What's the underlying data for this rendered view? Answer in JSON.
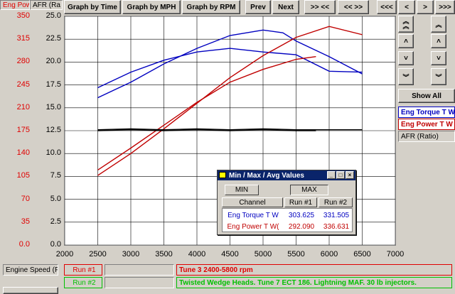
{
  "toolbar": {
    "eng_pow_label": "Eng Pow",
    "afr_label": "AFR (Ra",
    "graph_by_time": "Graph by Time",
    "graph_by_mph": "Graph by MPH",
    "graph_by_rpm": "Graph by RPM",
    "prev": "Prev",
    "next": "Next",
    "zoom_in": ">> <<",
    "zoom_out": "<< >>",
    "scroll_far_left": "<<<",
    "scroll_left": "<",
    "scroll_right": ">",
    "scroll_far_right": ">>>"
  },
  "left_axis": {
    "ticks": [
      "350",
      "315",
      "280",
      "245",
      "210",
      "175",
      "140",
      "105",
      "70",
      "35",
      "0.0"
    ],
    "color": "#e00000"
  },
  "right_panel": {
    "show_all": "Show All",
    "legend": [
      {
        "label": "Eng Torque T W",
        "color": "#0000c0"
      },
      {
        "label": "Eng Power T W",
        "color": "#c00000"
      },
      {
        "label": "AFR (Ratio)",
        "color": "#000000"
      }
    ]
  },
  "chart_data": {
    "type": "line",
    "x_ticks": [
      "2000",
      "2500",
      "3000",
      "3500",
      "4000",
      "4500",
      "5000",
      "5500",
      "6000",
      "6500",
      "7000"
    ],
    "xlim": [
      2000,
      7000
    ],
    "ylim": [
      0,
      25
    ],
    "y_ticks": [
      "25.0",
      "22.5",
      "20.0",
      "17.5",
      "15.0",
      "12.5",
      "10.0",
      "7.5",
      "5.0",
      "2.5",
      "0.0"
    ],
    "grid": true,
    "series": [
      {
        "color": "#0000c0",
        "x": [
          2500,
          3000,
          3500,
          4000,
          4500,
          5000,
          5500,
          6000,
          6500
        ],
        "y": [
          17.2,
          18.9,
          20.2,
          21.1,
          21.5,
          21.1,
          20.8,
          19.0,
          18.9
        ]
      },
      {
        "color": "#0000c0",
        "x": [
          2500,
          3000,
          3500,
          4000,
          4500,
          5000,
          5300,
          5500,
          6000,
          6500
        ],
        "y": [
          16.1,
          17.8,
          19.8,
          21.5,
          22.9,
          23.5,
          23.2,
          22.3,
          20.6,
          18.7
        ]
      },
      {
        "color": "#c00000",
        "x": [
          2500,
          3000,
          3500,
          4000,
          4500,
          5000,
          5500,
          5800
        ],
        "y": [
          8.2,
          10.6,
          13.1,
          15.6,
          17.8,
          19.2,
          20.3,
          20.6
        ]
      },
      {
        "color": "#c00000",
        "x": [
          2500,
          3000,
          3500,
          4000,
          4500,
          5000,
          5500,
          6000,
          6500
        ],
        "y": [
          7.6,
          10.0,
          12.7,
          15.5,
          18.3,
          20.7,
          22.7,
          23.9,
          23.0
        ]
      },
      {
        "color": "#000000",
        "x": [
          2500,
          3000,
          3500,
          4000,
          4500,
          5000,
          5500,
          5800
        ],
        "y": [
          12.5,
          12.6,
          12.5,
          12.6,
          12.5,
          12.6,
          12.5,
          12.5
        ]
      },
      {
        "color": "#000000",
        "x": [
          2500,
          3000,
          3500,
          4000,
          4500,
          5000,
          5500,
          6000,
          6500
        ],
        "y": [
          12.6,
          12.7,
          12.6,
          12.7,
          12.6,
          12.7,
          12.6,
          12.6,
          12.6
        ]
      }
    ]
  },
  "dialog": {
    "title": "Min / Max / Avg Values",
    "min_tab": "MIN",
    "max_tab": "MAX",
    "col_channel": "Channel",
    "col_run1": "Run #1",
    "col_run2": "Run #2",
    "rows": [
      {
        "channel": "Eng Torque T W",
        "run1": "303.625",
        "run2": "331.505",
        "color": "#0000c0"
      },
      {
        "channel": "Eng Power T W(",
        "run1": "292.090",
        "run2": "336.631",
        "color": "#c00000"
      }
    ]
  },
  "bottom": {
    "engine_speed": "Engine Speed (F",
    "run1_label": "Run #1",
    "run2_label": "Run #2",
    "run1_desc": "Tune 3 2400-5800 rpm",
    "run2_desc": "Twisted Wedge Heads. Tune 7 ECT 186. Lightning MAF. 30 lb injectors."
  }
}
